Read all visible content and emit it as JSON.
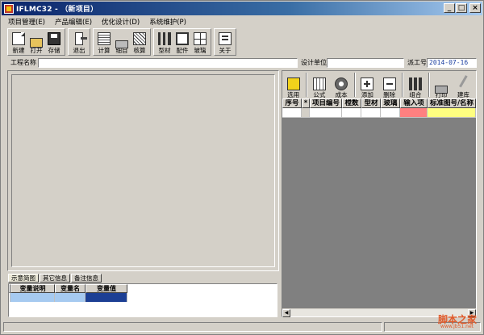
{
  "window": {
    "title": "IFLMC32 - （新项目）",
    "minimize": "_",
    "maximize": "□",
    "close": "×"
  },
  "menu": [
    "项目管理(E)",
    "产品编辑(E)",
    "优化设计(D)",
    "系统维护(P)"
  ],
  "toolbar": {
    "group1": [
      {
        "label": "新建",
        "icon": "new-file-icon"
      },
      {
        "label": "打开",
        "icon": "open-folder-icon"
      },
      {
        "label": "存储",
        "icon": "save-disk-icon"
      }
    ],
    "group2": [
      {
        "label": "退出",
        "icon": "exit-door-icon"
      }
    ],
    "group3": [
      {
        "label": "计算",
        "icon": "calculate-icon"
      },
      {
        "label": "细目",
        "icon": "print-detail-icon"
      },
      {
        "label": "核算",
        "icon": "check-icon"
      }
    ],
    "group4": [
      {
        "label": "型材",
        "icon": "profile-icon"
      },
      {
        "label": "配件",
        "icon": "part-icon"
      },
      {
        "label": "玻璃",
        "icon": "glass-icon"
      }
    ],
    "group5": [
      {
        "label": "关于",
        "icon": "about-icon"
      }
    ]
  },
  "form": {
    "project_name_label": "工程名称",
    "project_name_value": "",
    "design_unit_label": "设计单位",
    "design_unit_value": "",
    "job_no_label": "派工号",
    "date_value": "2014-07-16"
  },
  "tabs": [
    "示意简图",
    "其它信息",
    "备注信息"
  ],
  "var_grid": {
    "headers": [
      "变量说明",
      "变量名",
      "变量值"
    ]
  },
  "right_toolbar": [
    {
      "label": "选用",
      "icon": "select-icon"
    },
    {
      "label": "公式",
      "icon": "formula-icon"
    },
    {
      "label": "成本",
      "icon": "cost-icon"
    },
    {
      "label": "添加",
      "icon": "add-icon"
    },
    {
      "label": "删除",
      "icon": "delete-icon"
    },
    {
      "label": "组合",
      "icon": "combine-icon"
    },
    {
      "label": "打印",
      "icon": "printer-icon"
    },
    {
      "label": "建库",
      "icon": "build-library-icon"
    }
  ],
  "item_grid": {
    "headers": [
      "序号",
      "*",
      "项目编号",
      "樘数",
      "型材",
      "玻璃",
      "输入项",
      "标准图号/名称"
    ]
  },
  "colors": {
    "input_highlight": "#ff8080",
    "name_highlight": "#ffff80",
    "var_selected": "#1c3f94",
    "var_light": "#a6caf0"
  },
  "watermark": {
    "text": "脚本之家",
    "sub": "www.jb51.net"
  }
}
